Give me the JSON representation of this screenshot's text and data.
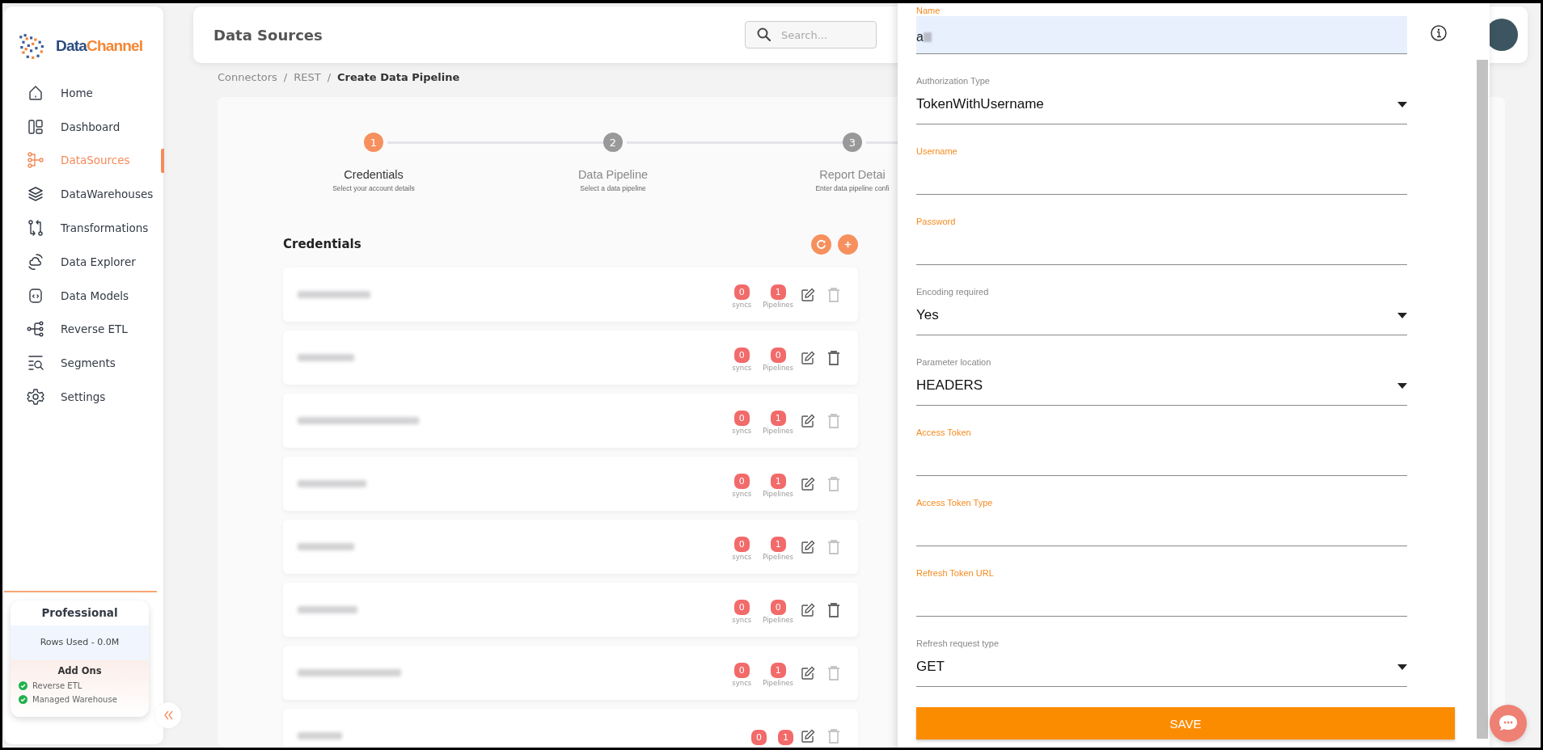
{
  "sidebar": {
    "logo": [
      {
        "text": "Data",
        "color": "#2b4c7e"
      },
      {
        "text": "Channel",
        "color": "#f58634"
      }
    ],
    "items": [
      {
        "label": "Home",
        "selected": false
      },
      {
        "label": "Dashboard",
        "selected": false
      },
      {
        "label": "DataSources",
        "selected": true
      },
      {
        "label": "DataWarehouses",
        "selected": false
      },
      {
        "label": "Transformations",
        "selected": false
      },
      {
        "label": "Data Explorer",
        "selected": false
      },
      {
        "label": "Data Models",
        "selected": false
      },
      {
        "label": "Reverse ETL",
        "selected": false
      },
      {
        "label": "Segments",
        "selected": false
      },
      {
        "label": "Settings",
        "selected": false
      }
    ],
    "plan": {
      "title": "Professional",
      "rows_used": "Rows Used - 0.0M",
      "addons_title": "Add Ons",
      "addons": [
        {
          "label": "Reverse ETL",
          "enabled": true
        },
        {
          "label": "Managed Warehouse",
          "enabled": true
        }
      ]
    }
  },
  "header": {
    "title": "Data Sources",
    "search": {
      "placeholder": "Search..."
    }
  },
  "breadcrumb": [
    {
      "label": "Connectors",
      "current": false
    },
    {
      "separator": "/"
    },
    {
      "label": "REST",
      "current": false
    },
    {
      "separator": "/"
    },
    {
      "label": "Create Data Pipeline",
      "current": true
    }
  ],
  "stepper": [
    {
      "number": "1",
      "title": "Credentials",
      "subtitle": "Select your account details",
      "selected": true
    },
    {
      "number": "2",
      "title": "Data Pipeline",
      "subtitle": "Select a data pipeline",
      "selected": false
    },
    {
      "number": "3",
      "title": "Report Detai",
      "subtitle": "Enter data pipeline confi",
      "selected": false
    }
  ],
  "credentials": {
    "title": "Credentials",
    "rows": [
      {
        "syncs": "0",
        "syncs_label": "syncs",
        "pipelines": "1",
        "pipelines_label": "Pipelines",
        "delete_disabled": true
      },
      {
        "syncs": "0",
        "syncs_label": "syncs",
        "pipelines": "0",
        "pipelines_label": "Pipelines",
        "delete_disabled": false
      },
      {
        "syncs": "0",
        "syncs_label": "syncs",
        "pipelines": "1",
        "pipelines_label": "Pipelines",
        "delete_disabled": true
      },
      {
        "syncs": "0",
        "syncs_label": "syncs",
        "pipelines": "1",
        "pipelines_label": "Pipelines",
        "delete_disabled": true
      },
      {
        "syncs": "0",
        "syncs_label": "syncs",
        "pipelines": "1",
        "pipelines_label": "Pipelines",
        "delete_disabled": true
      },
      {
        "syncs": "0",
        "syncs_label": "syncs",
        "pipelines": "0",
        "pipelines_label": "Pipelines",
        "delete_disabled": false
      },
      {
        "syncs": "0",
        "syncs_label": "syncs",
        "pipelines": "1",
        "pipelines_label": "Pipelines",
        "delete_disabled": true
      },
      {
        "syncs": "0",
        "pipelines": "1",
        "delete_disabled": true
      }
    ]
  },
  "form": {
    "fields": [
      {
        "kind": "text",
        "label": "Name",
        "value": "a",
        "required": true,
        "autofilled": true
      },
      {
        "kind": "select",
        "label": "Authorization Type",
        "value": "TokenWithUsername",
        "required": false
      },
      {
        "kind": "text",
        "label": "Username",
        "required": true,
        "autofilled": false
      },
      {
        "kind": "text",
        "label": "Password",
        "required": true,
        "autofilled": false
      },
      {
        "kind": "select",
        "label": "Encoding required",
        "value": "Yes",
        "required": false
      },
      {
        "kind": "select",
        "label": "Parameter location",
        "value": "HEADERS",
        "required": false
      },
      {
        "kind": "text",
        "label": "Access Token",
        "required": true,
        "autofilled": false
      },
      {
        "kind": "text",
        "label": "Access Token Type",
        "required": true,
        "autofilled": false
      },
      {
        "kind": "text",
        "label": "Refresh Token URL",
        "required": true,
        "autofilled": false
      },
      {
        "kind": "select",
        "label": "Refresh request type",
        "value": "GET",
        "required": false
      }
    ],
    "save": "SAVE"
  }
}
